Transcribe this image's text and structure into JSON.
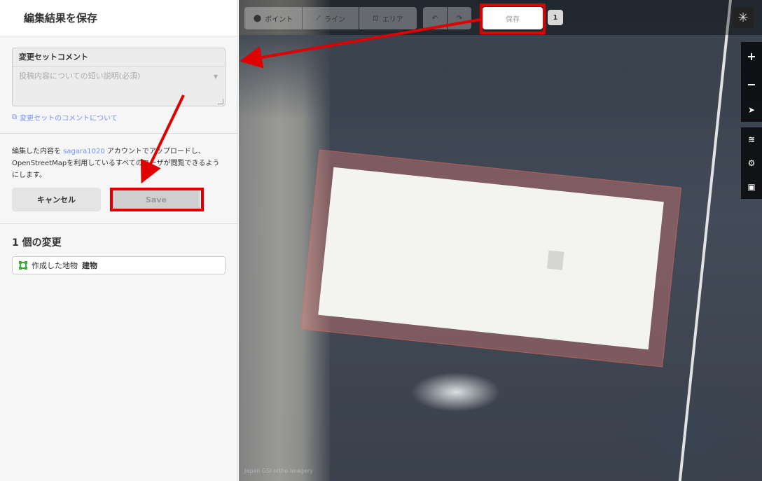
{
  "sidebar": {
    "title": "編集結果を保存",
    "comment": {
      "label": "変更セットコメント",
      "placeholder": "投稿内容についての短い説明(必須)",
      "about_link": "変更セットのコメントについて"
    },
    "upload": {
      "text_before": "編集した内容を ",
      "username": "sagara1020",
      "text_after": " アカウントでアップロードし、OpenStreetMapを利用しているすべてのユーザが閲覧できるようにします。"
    },
    "buttons": {
      "cancel": "キャンセル",
      "save": "Save"
    },
    "changes": {
      "title": "1 個の変更",
      "items": [
        {
          "action": "作成した地物",
          "kind": "建物"
        }
      ]
    }
  },
  "toolbar": {
    "point": "ポイント",
    "line": "ライン",
    "area": "エリア",
    "undo_icon": "↶",
    "redo_icon": "↷",
    "save": "保存",
    "count": "1"
  },
  "map_controls": {
    "zoom_in": "+",
    "zoom_out": "−",
    "locate": "➤",
    "layers": "≋",
    "map_data": "⚙",
    "help": "▣"
  },
  "attribution": "Japan GSI ortho Imagery",
  "colors": {
    "accent_link": "#7092ff",
    "annotation_red": "#e00000",
    "building_fill": "#f08278"
  }
}
